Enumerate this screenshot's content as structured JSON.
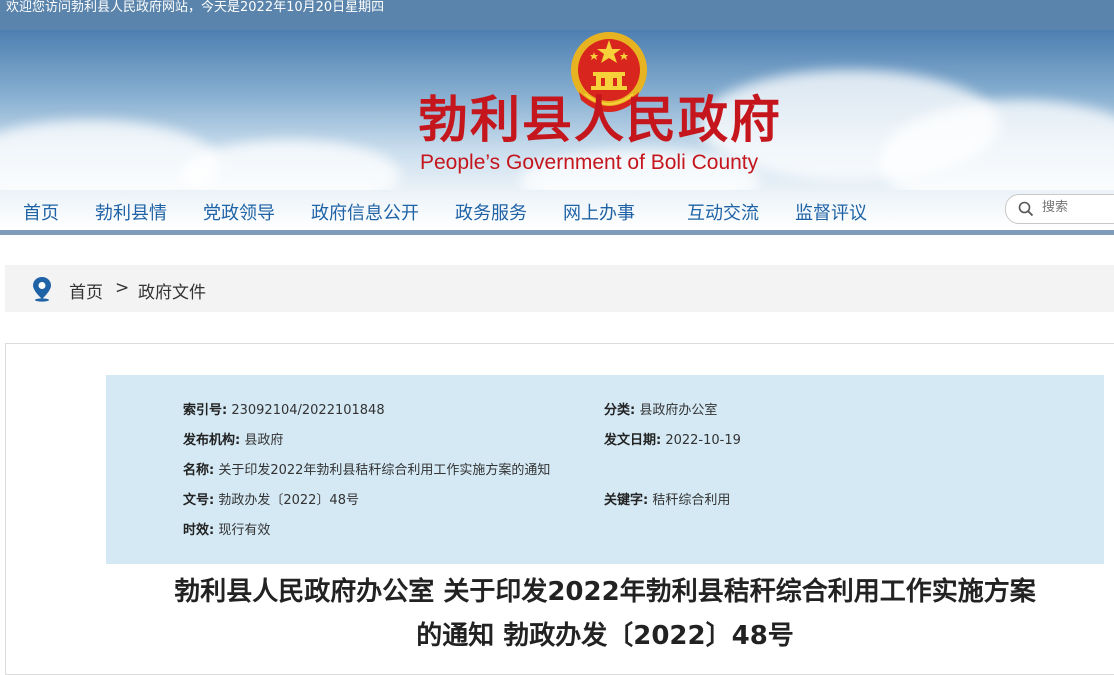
{
  "top_bar": {
    "welcome": "欢迎您访问勃利县人民政府网站，今天是2022年10月20日星期四"
  },
  "header": {
    "title_cn": "勃利县人民政府",
    "title_en": "People’s Government of Boli County"
  },
  "nav": {
    "items": [
      {
        "label": "首页"
      },
      {
        "label": "勃利县情"
      },
      {
        "label": "党政领导"
      },
      {
        "label": "政府信息公开"
      },
      {
        "label": "政务服务"
      },
      {
        "label": "网上办事"
      },
      {
        "label": "互动交流"
      },
      {
        "label": "监督评议"
      }
    ]
  },
  "search": {
    "placeholder": "搜索"
  },
  "breadcrumb": {
    "home": "首页",
    "separator": ">",
    "current": "政府文件"
  },
  "metadata": {
    "index_label": "索引号:",
    "index_value": "23092104/2022101848",
    "category_label": "分类:",
    "category_value": "县政府办公室",
    "publisher_label": "发布机构:",
    "publisher_value": "县政府",
    "date_label": "发文日期:",
    "date_value": "2022-10-19",
    "name_label": "名称:",
    "name_value": "关于印发2022年勃利县秸秆综合利用工作实施方案的通知",
    "doc_no_label": "文号:",
    "doc_no_value": "勃政办发〔2022〕48号",
    "keyword_label": "关键字:",
    "keyword_value": "秸秆综合利用",
    "validity_label": "时效:",
    "validity_value": "现行有效"
  },
  "document": {
    "title_line1": "勃利县人民政府办公室 关于印发2022年勃利县秸秆综合利用工作实施方案",
    "title_line2": "的通知  勃政办发〔2022〕48号"
  },
  "colors": {
    "top_bar": "#5a84ab",
    "title_red": "#c4161c",
    "nav_text": "#1f63a6",
    "meta_bg": "#d4e9f4"
  }
}
